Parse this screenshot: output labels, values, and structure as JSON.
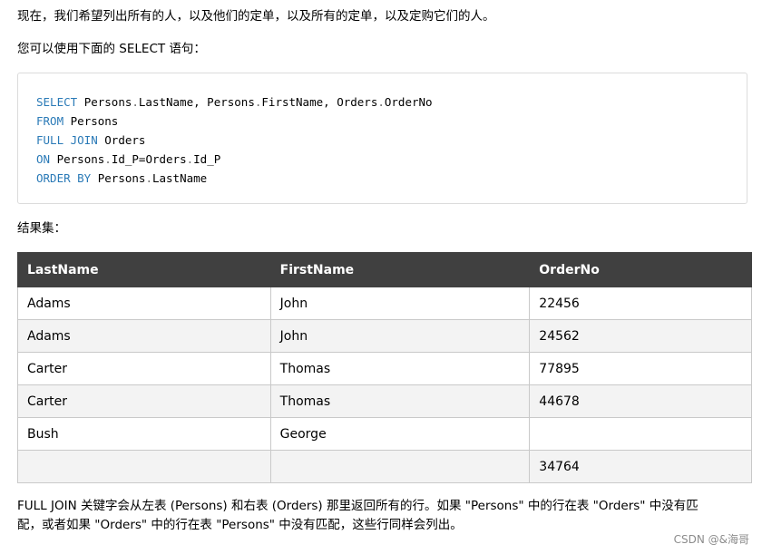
{
  "intro_text": "现在，我们希望列出所有的人，以及他们的定单，以及所有的定单，以及定购它们的人。",
  "select_hint": "您可以使用下面的 SELECT 语句：",
  "code": {
    "line1": {
      "kw": "SELECT",
      "a": "Persons",
      "b": "LastName,",
      "c": "Persons",
      "d": "FirstName,",
      "e": "Orders",
      "f": "OrderNo"
    },
    "line2": {
      "kw": "FROM",
      "rest": "Persons"
    },
    "line3": {
      "kw": "FULL JOIN",
      "rest": "Orders"
    },
    "line4": {
      "kw": "ON",
      "a": "Persons",
      "b": "Id_P=Orders",
      "c": "Id_P"
    },
    "line5": {
      "kw": "ORDER BY",
      "a": "Persons",
      "b": "LastName"
    }
  },
  "result_label": "结果集：",
  "table": {
    "headers": [
      "LastName",
      "FirstName",
      "OrderNo"
    ],
    "rows": [
      [
        "Adams",
        "John",
        "22456"
      ],
      [
        "Adams",
        "John",
        "24562"
      ],
      [
        "Carter",
        "Thomas",
        "77895"
      ],
      [
        "Carter",
        "Thomas",
        "44678"
      ],
      [
        "Bush",
        "George",
        ""
      ],
      [
        "",
        "",
        "34764"
      ]
    ]
  },
  "footer_line1": "FULL JOIN 关键字会从左表 (Persons) 和右表 (Orders) 那里返回所有的行。如果 \"Persons\" 中的行在表 \"Orders\" 中没有匹",
  "footer_line2": "配，或者如果 \"Orders\" 中的行在表 \"Persons\" 中没有匹配，这些行同样会列出。",
  "watermark": "CSDN @&海哥"
}
